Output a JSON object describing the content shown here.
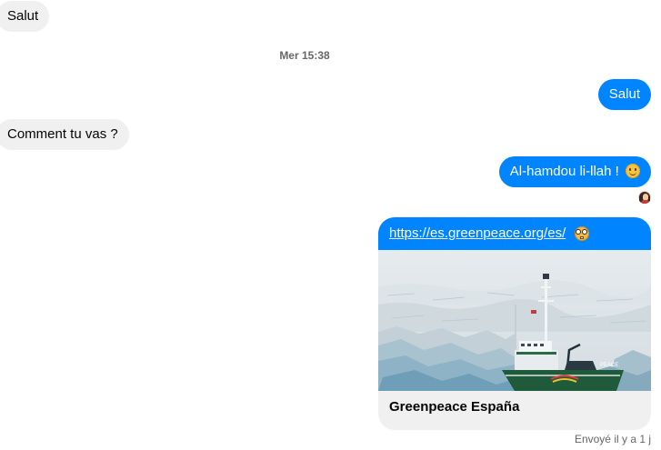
{
  "conversation": {
    "messages": [
      {
        "direction": "incoming",
        "text": "Salut"
      },
      {
        "direction": "outgoing",
        "text": "Salut"
      },
      {
        "direction": "incoming",
        "text": "Comment tu vas ?"
      },
      {
        "direction": "outgoing",
        "text": "Al-hamdou li-llah !",
        "emoji": "slightly-smiling-face-icon"
      }
    ],
    "timestamp": "Mer 15:38",
    "link_preview": {
      "url": "https://es.greenpeace.org/es/",
      "emoji": "nerd-face-icon",
      "title": "Greenpeace España"
    },
    "sent_status": "Envoyé il y a 1 j"
  },
  "colors": {
    "outgoing_bubble": "#0084ff",
    "incoming_bubble": "#f0f0f0",
    "meta_text": "#65676b"
  }
}
